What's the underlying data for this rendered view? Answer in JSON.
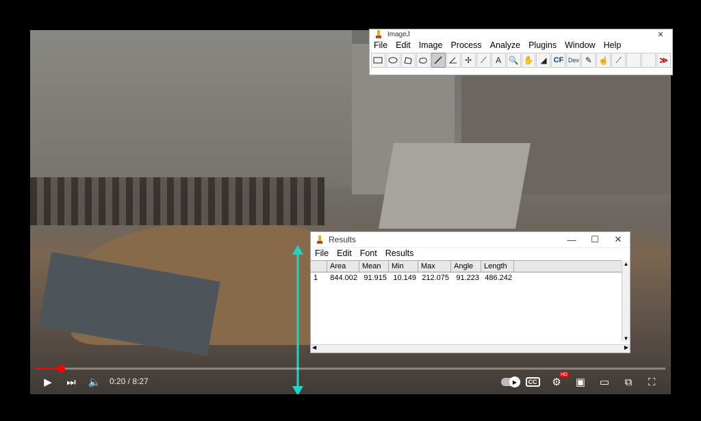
{
  "video": {
    "timecode": "0:20 / 8:27",
    "progress_fraction": 0.04,
    "hd_badge": "HD",
    "cc_label": "CC"
  },
  "imagej": {
    "title": "ImageJ",
    "menu": [
      "File",
      "Edit",
      "Image",
      "Process",
      "Analyze",
      "Plugins",
      "Window",
      "Help"
    ],
    "tools": [
      "rectangle-tool-icon",
      "oval-tool-icon",
      "polygon-tool-icon",
      "freehand-tool-icon",
      "straight-line-tool-icon",
      "angle-tool-icon",
      "point-tool-icon",
      "wand-tool-icon",
      "text-tool-icon",
      "magnifier-tool-icon",
      "hand-tool-icon",
      "dropper-tool-icon",
      "cf-tool-icon",
      "dev-tool-icon",
      "brush-tool-icon",
      "hand-tool-2-icon",
      "pipette-tool-icon",
      "empty-slot-icon",
      "empty-slot-icon",
      "more-tools-icon"
    ],
    "cf_label": "CF",
    "dev_label": "Dev"
  },
  "results": {
    "title": "Results",
    "menu": [
      "File",
      "Edit",
      "Font",
      "Results"
    ],
    "columns": [
      "",
      "Area",
      "Mean",
      "Min",
      "Max",
      "Angle",
      "Length"
    ],
    "rows": [
      [
        "1",
        "844.002",
        "91.915",
        "10.149",
        "212.075",
        "91.223",
        "486.242"
      ]
    ]
  },
  "colors": {
    "measure_line": "#22d3c5",
    "progress": "#ff0000"
  }
}
